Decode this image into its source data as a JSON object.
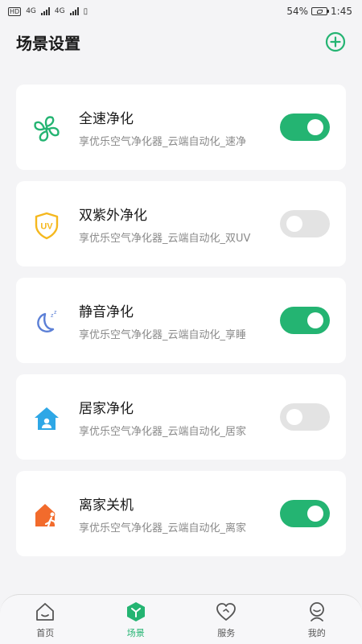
{
  "status_bar": {
    "left_labels": [
      "4G",
      "4G"
    ],
    "battery_percent": "54%",
    "time": "1:45"
  },
  "header": {
    "title": "场景设置",
    "add_icon": "plus-circle-icon"
  },
  "scenes": [
    {
      "name": "全速净化",
      "description": "享优乐空气净化器_云端自动化_速净",
      "icon": "fan-icon",
      "enabled": true
    },
    {
      "name": "双紫外净化",
      "description": "享优乐空气净化器_云端自动化_双UV",
      "icon": "uv-shield-icon",
      "enabled": false
    },
    {
      "name": "静音净化",
      "description": "享优乐空气净化器_云端自动化_享睡",
      "icon": "moon-icon",
      "enabled": true
    },
    {
      "name": "居家净化",
      "description": "享优乐空气净化器_云端自动化_居家",
      "icon": "home-person-icon",
      "enabled": false
    },
    {
      "name": "离家关机",
      "description": "享优乐空气净化器_云端自动化_离家",
      "icon": "leave-home-icon",
      "enabled": true
    }
  ],
  "bottom_nav": [
    {
      "label": "首页",
      "icon": "home-icon",
      "active": false
    },
    {
      "label": "场景",
      "icon": "scene-icon",
      "active": true
    },
    {
      "label": "服务",
      "icon": "heart-icon",
      "active": false
    },
    {
      "label": "我的",
      "icon": "profile-icon",
      "active": false
    }
  ],
  "colors": {
    "accent": "#24b472",
    "toggle_off": "#e3e3e3",
    "uv_icon": "#f5b81e",
    "moon_icon": "#5b7fd6",
    "home_icon": "#2ea7e6",
    "leave_icon": "#f26b2c"
  }
}
